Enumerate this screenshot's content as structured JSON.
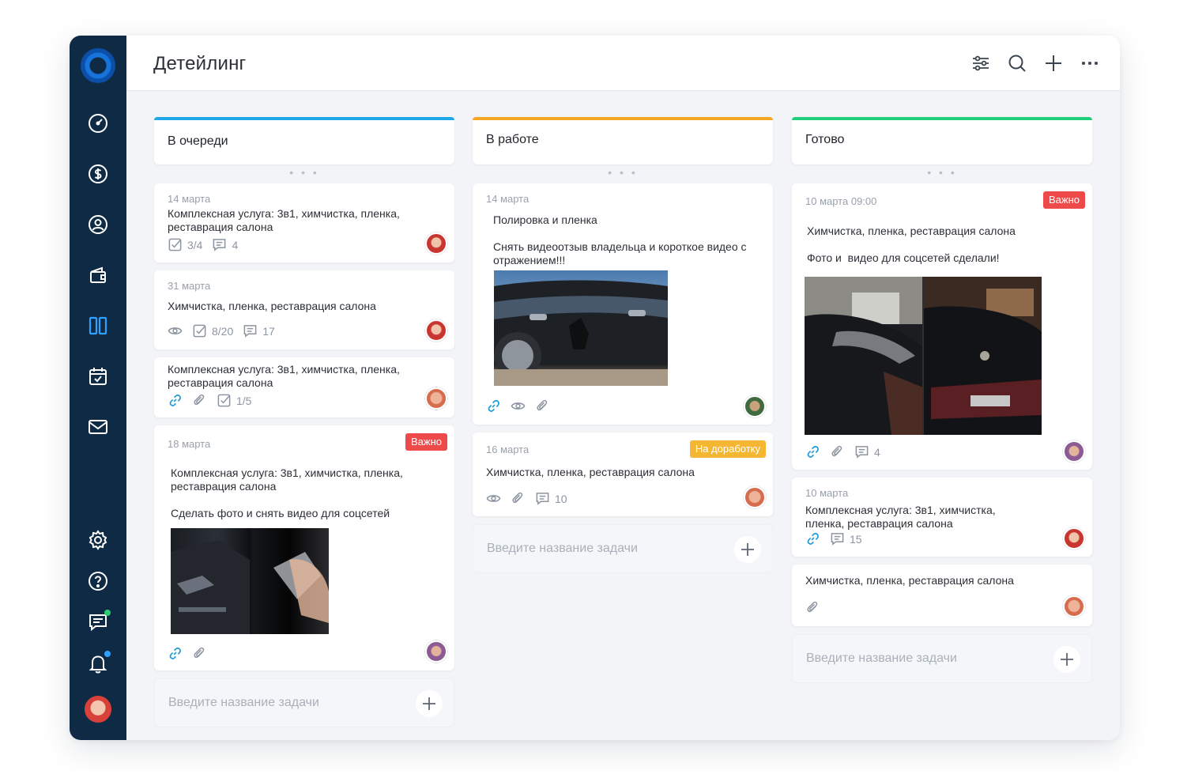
{
  "board": {
    "title": "Детейлинг",
    "add_placeholder": "Введите название задачи"
  },
  "sidebar": {
    "items": [
      {
        "icon": "dashboard-icon"
      },
      {
        "icon": "dollar-icon"
      },
      {
        "icon": "user-icon"
      },
      {
        "icon": "wallet-icon"
      },
      {
        "icon": "board-icon",
        "active": true
      },
      {
        "icon": "calendar-icon"
      },
      {
        "icon": "mail-icon"
      },
      {
        "icon": "settings-icon"
      },
      {
        "icon": "help-icon"
      },
      {
        "icon": "chat-icon"
      },
      {
        "icon": "bell-icon"
      }
    ],
    "accent": "#2ea0ff"
  },
  "topbar": {
    "icons": [
      "filter-icon",
      "search-icon",
      "plus-icon",
      "more-icon"
    ]
  },
  "columns": [
    {
      "title": "В очереди",
      "color": "#1ea8e8",
      "cards": [
        {
          "date": "14 марта",
          "title": "Комплексная услуга: 3в1, химчистка, пленка, реставрация салона",
          "checklist": "3/4",
          "comments": "4"
        },
        {
          "date": "31 марта",
          "title": "Химчистка, пленка, реставрация салона",
          "checklist": "8/20",
          "comments": "17"
        },
        {
          "title": "Комплексная услуга: 3в1, химчистка, пленка, реставрация салона",
          "checklist": "1/5"
        },
        {
          "date": "18 марта",
          "badge": "Важно",
          "title": "Комплексная услуга: 3в1, химчистка, пленка, реставрация салона",
          "text": "Сделать фото и снять видео для соцсетей"
        }
      ]
    },
    {
      "title": "В работе",
      "color": "#f5a623",
      "cards": [
        {
          "date": "14 марта",
          "title": "Полировка и пленка",
          "text": "Снять видеоотзыв владельца и короткое видео с отражением!!!"
        },
        {
          "date": "16 марта",
          "badge": "На доработку",
          "title": "Химчистка, пленка, реставрация салона",
          "comments": "10"
        }
      ]
    },
    {
      "title": "Готово",
      "color": "#1fcf7b",
      "cards": [
        {
          "date": "10 марта 09:00",
          "badge": "Важно",
          "title": "Химчистка, пленка, реставрация салона",
          "text": "Фото и  видео для соцсетей сделали!",
          "comments": "4"
        },
        {
          "date": "10 марта",
          "title": "Комплексная услуга: 3в1, химчистка, пленка, реставрация салона",
          "comments": "15"
        },
        {
          "title": "Химчистка, пленка, реставрация салона"
        }
      ]
    }
  ]
}
